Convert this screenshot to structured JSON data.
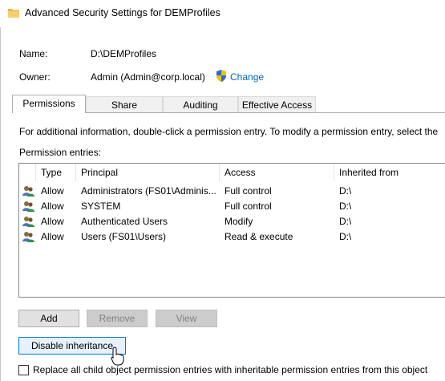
{
  "window": {
    "title": "Advanced Security Settings for DEMProfiles",
    "folder_color": "#e8b84a"
  },
  "info": {
    "name_label": "Name:",
    "name_value": "D:\\DEMProfiles",
    "owner_label": "Owner:",
    "owner_value": "Admin (Admin@corp.local)",
    "change_link": "Change"
  },
  "tabs": [
    {
      "label": "Permissions",
      "active": true
    },
    {
      "label": "Share",
      "active": false
    },
    {
      "label": "Auditing",
      "active": false
    },
    {
      "label": "Effective Access",
      "active": false
    }
  ],
  "permissions": {
    "info_text": "For additional information, double-click a permission entry. To modify a permission entry, select the",
    "entries_label": "Permission entries:",
    "columns": [
      "Type",
      "Principal",
      "Access",
      "Inherited from"
    ],
    "rows": [
      {
        "type": "Allow",
        "principal": "Administrators (FS01\\Adminis...",
        "access": "Full control",
        "inherited": "D:\\"
      },
      {
        "type": "Allow",
        "principal": "SYSTEM",
        "access": "Full control",
        "inherited": "D:\\"
      },
      {
        "type": "Allow",
        "principal": "Authenticated Users",
        "access": "Modify",
        "inherited": "D:\\"
      },
      {
        "type": "Allow",
        "principal": "Users (FS01\\Users)",
        "access": "Read & execute",
        "inherited": "D:\\"
      }
    ]
  },
  "buttons": {
    "add": "Add",
    "remove": "Remove",
    "view": "View",
    "disable_inheritance": "Disable inheritance"
  },
  "replace_checkbox": {
    "label": "Replace all child object permission entries with inheritable permission entries from this object",
    "checked": false
  },
  "colors": {
    "link": "#0066cc",
    "focus_border": "#0078d7",
    "disabled_text": "#838383"
  }
}
